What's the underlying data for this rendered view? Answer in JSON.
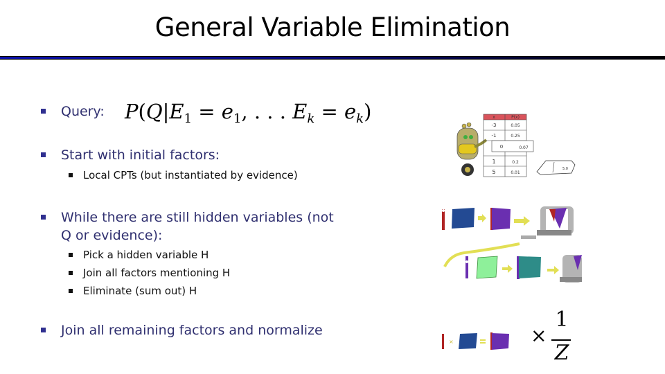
{
  "slide": {
    "title": "General Variable Elimination",
    "colors": {
      "title_rule_start": "#0a10a8",
      "title_rule_end": "#000000",
      "level1_text": "#303070",
      "level2_text": "#111111"
    }
  },
  "bullets": {
    "query_label": "Query:",
    "query_formula": {
      "P": "P",
      "open": "(",
      "Q": "Q",
      "given": "|",
      "E": "E",
      "sub1": "1",
      "eq": " = ",
      "e": "e",
      "comma_dots": ", . . . ",
      "subk": "k",
      "close": ")"
    },
    "start": "Start with initial factors:",
    "start_sub": [
      "Local CPTs (but instantiated by evidence)"
    ],
    "while_line1": "While there are still hidden variables (not",
    "while_line2": "Q or evidence):",
    "while_sub": [
      "Pick a hidden variable H",
      "Join all factors mentioning H",
      "Eliminate (sum out) H"
    ],
    "final": "Join all remaining factors and normalize"
  },
  "cpt_table": {
    "header": [
      "x",
      "P(x)"
    ],
    "rows": [
      [
        "-3",
        "0.05"
      ],
      [
        "-1",
        "0.25"
      ],
      [
        "0",
        "0.07"
      ],
      [
        "1",
        "0.2"
      ],
      [
        "5",
        "0.01"
      ]
    ],
    "scale_label": "5.0"
  },
  "normalize": {
    "times": "×",
    "numerator": "1",
    "denominator": "Z"
  },
  "illustration_colors": {
    "factor_blue": "#234a93",
    "factor_purple": "#6a2fb0",
    "factor_green": "#8ef09a",
    "factor_teal": "#2e8c88",
    "arrow_yellow": "#e2df55",
    "clamp_gray": "#b4b4b4",
    "pin_red": "#b02525"
  }
}
